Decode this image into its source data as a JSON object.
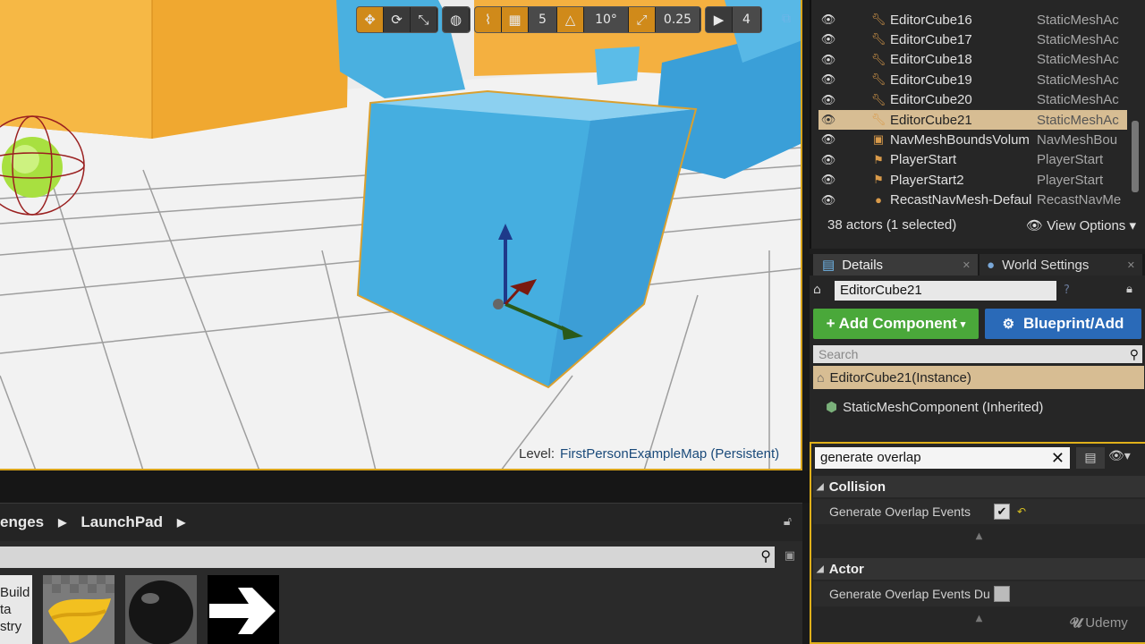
{
  "viewport": {
    "toolbar": {
      "translate_icon": "move-icon",
      "rotate_icon": "rotate-icon",
      "scale_icon": "scale-icon",
      "world_icon": "globe-icon",
      "surface_snap_icon": "surface-snap-icon",
      "grid_icon": "grid-icon",
      "grid_snap_value": "5",
      "rotation_icon": "angle-icon",
      "rotation_snap_value": "10°",
      "scale_snap_icon": "scale-snap-icon",
      "scale_snap_value": "0.25",
      "camera_speed_icon": "camera-speed-icon",
      "camera_speed_value": "4"
    },
    "level_label": "Level:",
    "level_name": "FirstPersonExampleMap (Persistent)"
  },
  "content_browser": {
    "breadcrumbs": [
      "enges",
      "LaunchPad"
    ],
    "thumb_build_text": [
      "Build",
      "ta",
      "stry"
    ]
  },
  "outliner": {
    "rows": [
      {
        "name": "EditorCube16",
        "type": "StaticMeshAc"
      },
      {
        "name": "EditorCube17",
        "type": "StaticMeshAc"
      },
      {
        "name": "EditorCube18",
        "type": "StaticMeshAc"
      },
      {
        "name": "EditorCube19",
        "type": "StaticMeshAc"
      },
      {
        "name": "EditorCube20",
        "type": "StaticMeshAc"
      },
      {
        "name": "EditorCube21",
        "type": "StaticMeshAc",
        "selected": true
      },
      {
        "name": "NavMeshBoundsVolum",
        "type": "NavMeshBou"
      },
      {
        "name": "PlayerStart",
        "type": "PlayerStart"
      },
      {
        "name": "PlayerStart2",
        "type": "PlayerStart"
      },
      {
        "name": "RecastNavMesh-Defaul",
        "type": "RecastNavMe"
      }
    ],
    "actor_count": "38 actors (1 selected)",
    "view_options": "View Options"
  },
  "tabs": {
    "details": "Details",
    "world_settings": "World Settings"
  },
  "details": {
    "actor_name": "EditorCube21",
    "add_component": "Add Component",
    "blueprint_add": "Blueprint/Add",
    "search_placeholder": "Search",
    "instance_label": "EditorCube21(Instance)",
    "mesh_component": "StaticMeshComponent (Inherited)",
    "property_search_value": "generate overlap",
    "categories": {
      "collision": "Collision",
      "collision_prop": "Generate Overlap Events",
      "actor": "Actor",
      "actor_prop": "Generate Overlap Events Du"
    }
  },
  "watermark": "Udemy",
  "colors": {
    "selection": "#d7bd93",
    "add_component": "#4aa83a",
    "blueprint": "#2a6ab8",
    "highlight_border": "#e0b01a"
  }
}
